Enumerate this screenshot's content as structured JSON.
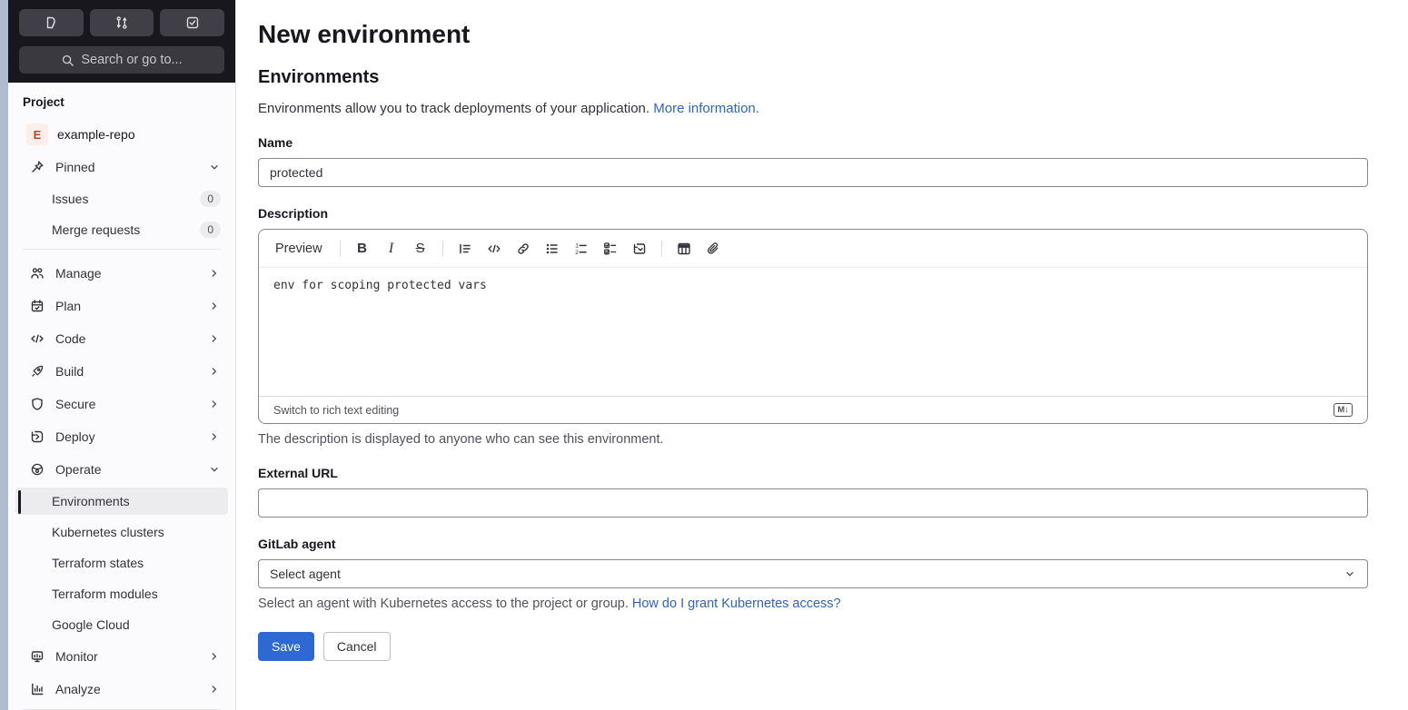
{
  "colors": {
    "accent_blue": "#2d68d3",
    "link_blue": "#2f63c5",
    "sidebar_bg": "#fbfafd",
    "sidebar_top_bg": "#18171d",
    "active_item_bg": "#ececef",
    "left_strip": "#aebccf",
    "input_border": "#89888d",
    "badge_bg": "#ececef",
    "avatar_bg": "#fcefe9",
    "avatar_text": "#b2492c"
  },
  "sidebar": {
    "top_buttons": [
      {
        "icon": "issue-document-icon"
      },
      {
        "icon": "merge-request-icon"
      },
      {
        "icon": "todo-check-icon"
      }
    ],
    "search": {
      "icon": "search-icon",
      "placeholder": "Search or go to..."
    },
    "section_label": "Project",
    "project": {
      "avatar_letter": "E",
      "name": "example-repo"
    },
    "pinned": {
      "label": "Pinned",
      "icon": "pin-icon",
      "items": [
        {
          "label": "Issues",
          "badge": "0"
        },
        {
          "label": "Merge requests",
          "badge": "0"
        }
      ]
    },
    "nav": [
      {
        "label": "Manage",
        "icon": "users-icon"
      },
      {
        "label": "Plan",
        "icon": "calendar-icon"
      },
      {
        "label": "Code",
        "icon": "code-icon"
      },
      {
        "label": "Build",
        "icon": "rocket-icon"
      },
      {
        "label": "Secure",
        "icon": "shield-icon"
      },
      {
        "label": "Deploy",
        "icon": "deploy-icon"
      },
      {
        "label": "Operate",
        "icon": "operate-icon",
        "expanded": true
      },
      {
        "label": "Monitor",
        "icon": "monitor-icon"
      },
      {
        "label": "Analyze",
        "icon": "chart-icon"
      }
    ],
    "operate_children": [
      {
        "label": "Environments",
        "active": true
      },
      {
        "label": "Kubernetes clusters"
      },
      {
        "label": "Terraform states"
      },
      {
        "label": "Terraform modules"
      },
      {
        "label": "Google Cloud"
      }
    ]
  },
  "main": {
    "title": "New environment",
    "section_title": "Environments",
    "intro_text": "Environments allow you to track deployments of your application.",
    "intro_link": "More information.",
    "name_field": {
      "label": "Name",
      "value": "protected"
    },
    "description_field": {
      "label": "Description",
      "toolbar": {
        "preview_label": "Preview",
        "bold_glyph": "B",
        "italic_glyph": "I",
        "strike_glyph": "S",
        "numbered_glyphs": [
          "1",
          "2"
        ],
        "icons": [
          "quote-icon",
          "code-icon",
          "link-icon",
          "bullet-list-icon",
          "numbered-list-icon",
          "task-list-icon",
          "collapsible-section-icon",
          "table-icon",
          "attach-file-icon"
        ]
      },
      "value": "env for scoping protected vars",
      "footer_link": "Switch to rich text editing",
      "markdown_badge": "M↓",
      "hint": "The description is displayed to anyone who can see this environment."
    },
    "external_url_field": {
      "label": "External URL",
      "value": ""
    },
    "agent_field": {
      "label": "GitLab agent",
      "value": "Select agent",
      "hint_text": "Select an agent with Kubernetes access to the project or group.",
      "hint_link": "How do I grant Kubernetes access?"
    },
    "actions": {
      "save_label": "Save",
      "cancel_label": "Cancel"
    }
  }
}
